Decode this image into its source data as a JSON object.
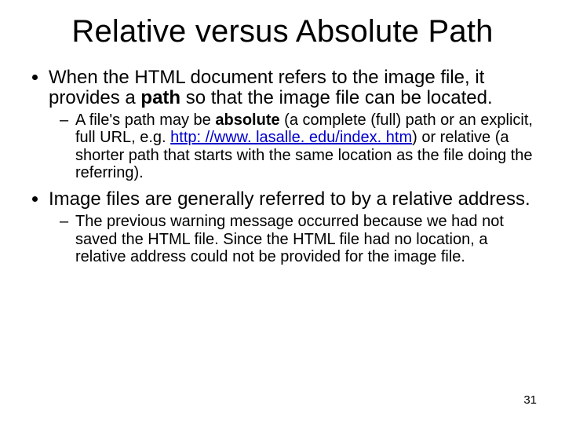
{
  "title": "Relative versus Absolute Path",
  "bullets": {
    "b1": {
      "pre": "When the HTML document refers to the image file, it provides a ",
      "bold": "path",
      "post": " so that the image file can be located."
    },
    "b1sub": {
      "pre": "A file's path may be ",
      "bold": "absolute",
      "mid": " (a complete (full) path or an explicit, full URL, e.g. ",
      "link": "http: //www. lasalle. edu/index. htm",
      "post": ") or relative (a shorter path that starts with the same location as the file doing the referring)."
    },
    "b2": "Image files are generally referred to by a relative address.",
    "b2sub": "The previous warning message occurred because we had not saved the HTML file.  Since the HTML file had no location, a relative address could not be provided for the image file."
  },
  "page_number": "31"
}
